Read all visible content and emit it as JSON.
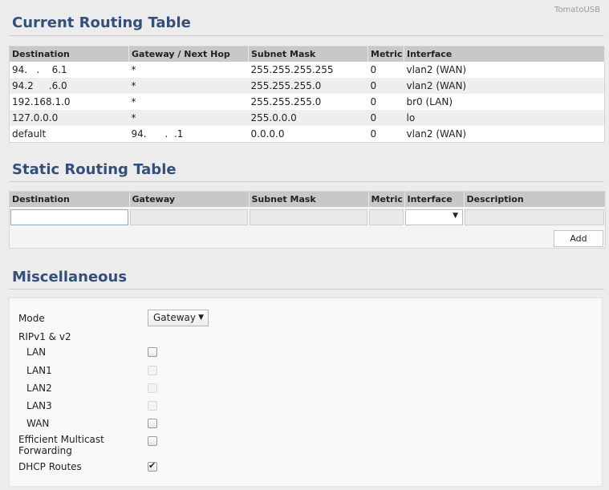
{
  "brand": "TomatoUSB",
  "current": {
    "title": "Current Routing Table",
    "headers": [
      "Destination",
      "Gateway / Next Hop",
      "Subnet Mask",
      "Metric",
      "Interface"
    ],
    "rows": [
      [
        "94.   .    6.1",
        "*",
        "255.255.255.255",
        "0",
        "vlan2 (WAN)"
      ],
      [
        "94.2     .6.0",
        "*",
        "255.255.255.0",
        "0",
        "vlan2 (WAN)"
      ],
      [
        "192.168.1.0",
        "*",
        "255.255.255.0",
        "0",
        "br0 (LAN)"
      ],
      [
        "127.0.0.0",
        "*",
        "255.0.0.0",
        "0",
        "lo"
      ],
      [
        "default",
        "94.      .  .1",
        "0.0.0.0",
        "0",
        "vlan2 (WAN)"
      ]
    ]
  },
  "static": {
    "title": "Static Routing Table",
    "headers": [
      "Destination",
      "Gateway",
      "Subnet Mask",
      "Metric",
      "Interface",
      "Description"
    ],
    "add_label": "Add"
  },
  "misc": {
    "title": "Miscellaneous",
    "mode_label": "Mode",
    "mode_value": "Gateway",
    "rip_label": "RIPv1 & v2",
    "lan": "LAN",
    "lan1": "LAN1",
    "lan2": "LAN2",
    "lan3": "LAN3",
    "wan": "WAN",
    "emf_line1": "Efficient Multicast",
    "emf_line2": "Forwarding",
    "dhcp_label": "DHCP Routes",
    "checkboxes": {
      "lan": false,
      "lan1": false,
      "lan2": false,
      "lan3": false,
      "wan": false,
      "emf": false,
      "dhcp": true
    }
  }
}
